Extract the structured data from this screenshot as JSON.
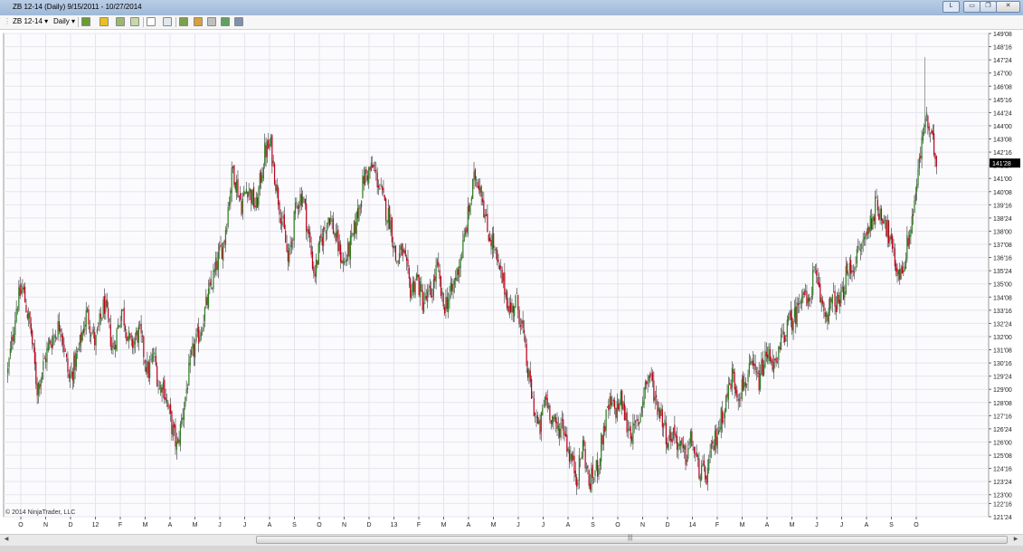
{
  "window": {
    "title": "ZB 12-14 (Daily)  9/15/2011 - 10/27/2014",
    "link_button": "L",
    "minimize_glyph": "▭",
    "maximize_glyph": "❐",
    "close_glyph": "✕"
  },
  "toolbar": {
    "instrument": "ZB 12-14",
    "interval": "Daily",
    "icons": [
      "bars-type-icon",
      "draw-pencil-icon",
      "indicator-icon",
      "strategy-icon",
      "cursor-icon",
      "zoom-icon",
      "data-box-icon",
      "properties-icon",
      "snapshot-icon",
      "export-icon",
      "panel-icon"
    ]
  },
  "chart": {
    "copyright": "© 2014 NinjaTrader, LLC",
    "last_price_label": "141'28",
    "colors": {
      "up": "#2e7d1f",
      "down": "#c0001a",
      "wick": "#333333",
      "grid": "#e4e4ec",
      "last_price_bg": "#000000"
    }
  },
  "chart_data": {
    "type": "candlestick",
    "title": "ZB 12-14 (Daily)  9/15/2011 - 10/27/2014",
    "y_ticks": [
      "149'08",
      "148'16",
      "147'24",
      "147'00",
      "146'08",
      "145'16",
      "144'24",
      "144'00",
      "143'08",
      "142'16",
      "141'24",
      "141'00",
      "140'08",
      "139'16",
      "138'24",
      "138'00",
      "137'08",
      "136'16",
      "135'24",
      "135'00",
      "134'08",
      "133'16",
      "132'24",
      "132'00",
      "131'08",
      "130'16",
      "129'24",
      "129'00",
      "128'08",
      "127'16",
      "126'24",
      "126'00",
      "125'08",
      "124'16",
      "123'24",
      "123'00",
      "122'16",
      "121'24"
    ],
    "ylim": [
      121.75,
      149.25
    ],
    "x_ticks": [
      "O",
      "N",
      "D",
      "12",
      "F",
      "M",
      "A",
      "M",
      "J",
      "J",
      "A",
      "S",
      "O",
      "N",
      "D",
      "13",
      "F",
      "M",
      "A",
      "M",
      "J",
      "J",
      "A",
      "S",
      "O",
      "N",
      "D",
      "14",
      "F",
      "M",
      "A",
      "M",
      "J",
      "J",
      "A",
      "S",
      "O"
    ],
    "close_path": [
      [
        0,
        130.0
      ],
      [
        3,
        133.8
      ],
      [
        5,
        134.8
      ],
      [
        8,
        132.2
      ],
      [
        10,
        129.0
      ],
      [
        14,
        131.5
      ],
      [
        18,
        132.8
      ],
      [
        21,
        129.5
      ],
      [
        24,
        131.0
      ],
      [
        27,
        133.4
      ],
      [
        30,
        131.6
      ],
      [
        33,
        133.9
      ],
      [
        36,
        131.2
      ],
      [
        39,
        133.6
      ],
      [
        42,
        131.4
      ],
      [
        45,
        132.3
      ],
      [
        48,
        129.9
      ],
      [
        50,
        131.0
      ],
      [
        52,
        128.9
      ],
      [
        53,
        129.5
      ],
      [
        56,
        127.0
      ],
      [
        58,
        125.6
      ],
      [
        60,
        127.8
      ],
      [
        63,
        130.9
      ],
      [
        66,
        132.4
      ],
      [
        69,
        134.5
      ],
      [
        72,
        136.4
      ],
      [
        74,
        137.4
      ],
      [
        77,
        141.6
      ],
      [
        80,
        139.5
      ],
      [
        82,
        140.6
      ],
      [
        85,
        139.3
      ],
      [
        88,
        142.5
      ],
      [
        90,
        142.9
      ],
      [
        92,
        140.5
      ],
      [
        95,
        137.5
      ],
      [
        96,
        136.1
      ],
      [
        99,
        139.7
      ],
      [
        101,
        140.1
      ],
      [
        103,
        137.7
      ],
      [
        105,
        135.5
      ],
      [
        107,
        137.3
      ],
      [
        110,
        139.0
      ],
      [
        113,
        137.2
      ],
      [
        115,
        136.1
      ],
      [
        118,
        137.5
      ],
      [
        120,
        139.2
      ],
      [
        122,
        141.1
      ],
      [
        125,
        141.6
      ],
      [
        127,
        140.7
      ],
      [
        129,
        139.4
      ],
      [
        131,
        138.6
      ],
      [
        133,
        136.2
      ],
      [
        135,
        136.9
      ],
      [
        138,
        134.6
      ],
      [
        140,
        135.4
      ],
      [
        142,
        134.0
      ],
      [
        145,
        134.4
      ],
      [
        147,
        136.0
      ],
      [
        149,
        133.7
      ],
      [
        152,
        134.5
      ],
      [
        154,
        135.8
      ],
      [
        156,
        137.2
      ],
      [
        158,
        139.3
      ],
      [
        160,
        141.2
      ],
      [
        162,
        140.6
      ],
      [
        164,
        138.1
      ],
      [
        166,
        137.4
      ],
      [
        168,
        135.8
      ],
      [
        170,
        134.9
      ],
      [
        172,
        133.4
      ],
      [
        174,
        134.1
      ],
      [
        176,
        132.7
      ],
      [
        178,
        130.0
      ],
      [
        180,
        128.1
      ],
      [
        182,
        126.5
      ],
      [
        184,
        128.6
      ],
      [
        186,
        127.6
      ],
      [
        188,
        126.6
      ],
      [
        190,
        127.2
      ],
      [
        192,
        125.5
      ],
      [
        195,
        124.0
      ],
      [
        197,
        125.9
      ],
      [
        199,
        123.6
      ],
      [
        202,
        124.6
      ],
      [
        204,
        126.7
      ],
      [
        206,
        128.1
      ],
      [
        208,
        127.8
      ],
      [
        210,
        128.4
      ],
      [
        212,
        127.0
      ],
      [
        214,
        126.5
      ],
      [
        216,
        127.1
      ],
      [
        218,
        129.2
      ],
      [
        220,
        129.8
      ],
      [
        222,
        128.3
      ],
      [
        224,
        127.5
      ],
      [
        226,
        126.1
      ],
      [
        228,
        126.6
      ],
      [
        230,
        125.7
      ],
      [
        232,
        125.1
      ],
      [
        234,
        126.2
      ],
      [
        236,
        124.7
      ],
      [
        239,
        123.9
      ],
      [
        241,
        125.4
      ],
      [
        243,
        126.6
      ],
      [
        246,
        128.4
      ],
      [
        248,
        129.8
      ],
      [
        250,
        128.8
      ],
      [
        252,
        129.3
      ],
      [
        255,
        130.2
      ],
      [
        257,
        129.4
      ],
      [
        259,
        130.6
      ],
      [
        261,
        131.1
      ],
      [
        263,
        130.0
      ],
      [
        265,
        131.9
      ],
      [
        267,
        132.6
      ],
      [
        270,
        133.3
      ],
      [
        272,
        134.9
      ],
      [
        274,
        133.6
      ],
      [
        276,
        135.7
      ],
      [
        278,
        134.3
      ],
      [
        280,
        133.3
      ],
      [
        283,
        134.1
      ],
      [
        285,
        133.8
      ],
      [
        287,
        135.4
      ],
      [
        290,
        136.2
      ],
      [
        292,
        137.0
      ],
      [
        295,
        138.3
      ],
      [
        297,
        139.4
      ],
      [
        300,
        138.9
      ],
      [
        302,
        137.5
      ],
      [
        304,
        136.0
      ],
      [
        306,
        135.5
      ],
      [
        308,
        137.2
      ],
      [
        310,
        139.1
      ],
      [
        312,
        141.6
      ],
      [
        313,
        143.0
      ],
      [
        314,
        144.6
      ],
      [
        316,
        143.3
      ],
      [
        318,
        142.2
      ]
    ],
    "last_price": "141'28"
  }
}
